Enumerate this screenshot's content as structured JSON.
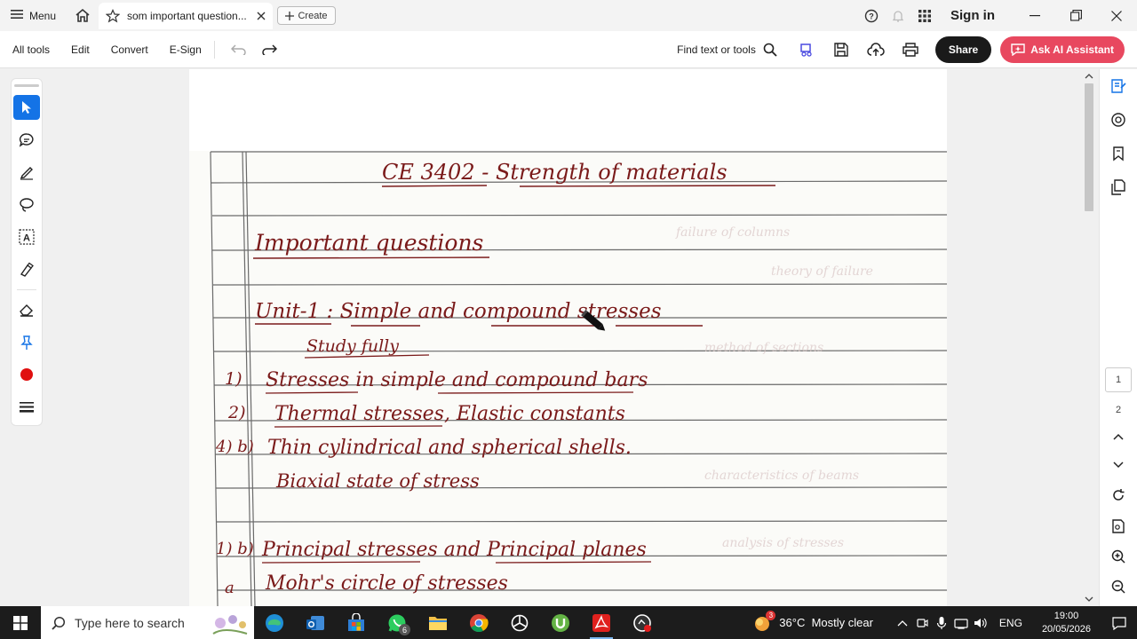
{
  "titlebar": {
    "menu_label": "Menu",
    "tab_title": "som important question...",
    "create_label": "Create",
    "signin_label": "Sign in"
  },
  "toolbar": {
    "all_tools": "All tools",
    "edit": "Edit",
    "convert": "Convert",
    "esign": "E-Sign",
    "find_text": "Find text or tools",
    "share": "Share",
    "ai_assistant": "Ask AI Assistant"
  },
  "document": {
    "title": "CE 3402 - Strength of materials",
    "heading": "Important questions",
    "unit1": "Unit-1 : Simple and compound stresses",
    "note": "Study fully",
    "lines": [
      {
        "num": "1)",
        "text": "Stresses in simple and compound bars"
      },
      {
        "num": "2)",
        "text": "Thermal stresses, Elastic constants"
      },
      {
        "num": "4) b)",
        "text": "Thin cylindrical and spherical shells."
      },
      {
        "num": "",
        "text": "Biaxial state of stress"
      },
      {
        "num": "1) b)",
        "text": "Principal stresses and Principal planes"
      },
      {
        "num": "a",
        "text": "Mohr's circle of stresses"
      }
    ]
  },
  "pages": {
    "page1": "1",
    "page2": "2"
  },
  "taskbar": {
    "search_placeholder": "Type here to search",
    "whatsapp_badge": "6",
    "weather": "36°C  Mostly clear",
    "weather_badge": "3",
    "lang": "ENG",
    "time": "19:00",
    "date": "20/05/2026"
  },
  "colors": {
    "accent": "#1473e6",
    "ai": "#e8485f",
    "ink": "#7a1a1a"
  }
}
